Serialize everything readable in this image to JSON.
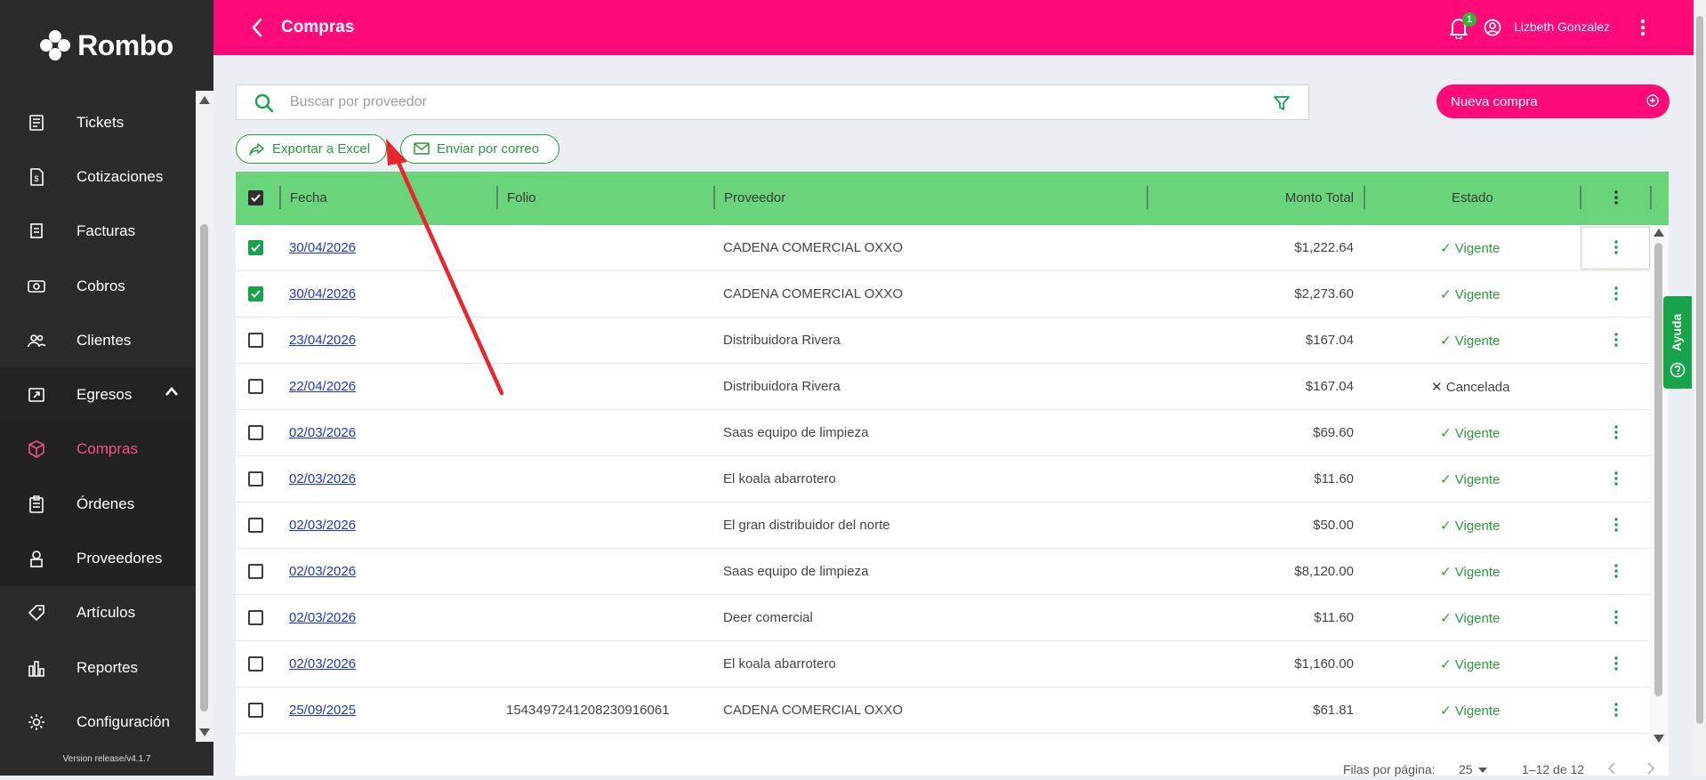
{
  "brand": {
    "name": "Rombo"
  },
  "sidebar": {
    "items": [
      {
        "label": "Tickets",
        "icon": "ticket-icon"
      },
      {
        "label": "Cotizaciones",
        "icon": "quote-icon"
      },
      {
        "label": "Facturas",
        "icon": "invoice-icon"
      },
      {
        "label": "Cobros",
        "icon": "cash-icon"
      },
      {
        "label": "Clientes",
        "icon": "clients-icon"
      },
      {
        "label": "Egresos",
        "icon": "expenses-icon"
      },
      {
        "label": "Compras",
        "icon": "box-icon"
      },
      {
        "label": "Órdenes",
        "icon": "clipboard-icon"
      },
      {
        "label": "Proveedores",
        "icon": "supplier-icon"
      },
      {
        "label": "Artículos",
        "icon": "tag-icon"
      },
      {
        "label": "Reportes",
        "icon": "chart-icon"
      },
      {
        "label": "Configuración",
        "icon": "gear-icon"
      }
    ],
    "version": "Version release/v4.1.7"
  },
  "header": {
    "title": "Compras",
    "notifications": "1",
    "user": "Lizbeth Gonzalez"
  },
  "search": {
    "placeholder": "Buscar por proveedor"
  },
  "actions": {
    "new": "Nueva compra",
    "export": "Exportar a Excel",
    "email": "Enviar por correo"
  },
  "table": {
    "columns": [
      "Fecha",
      "Folio",
      "Proveedor",
      "Monto Total",
      "Estado"
    ],
    "rows": [
      {
        "checked": true,
        "date": "30/04/2026",
        "folio": "",
        "supplier": "CADENA COMERCIAL OXXO",
        "amount": "$1,222.64",
        "status": "Vigente"
      },
      {
        "checked": true,
        "date": "30/04/2026",
        "folio": "",
        "supplier": "CADENA COMERCIAL OXXO",
        "amount": "$2,273.60",
        "status": "Vigente"
      },
      {
        "checked": false,
        "date": "23/04/2026",
        "folio": "",
        "supplier": "Distribuidora Rivera",
        "amount": "$167.04",
        "status": "Vigente"
      },
      {
        "checked": false,
        "date": "22/04/2026",
        "folio": "",
        "supplier": "Distribuidora Rivera",
        "amount": "$167.04",
        "status": "Cancelada"
      },
      {
        "checked": false,
        "date": "02/03/2026",
        "folio": "",
        "supplier": "Saas equipo de limpieza",
        "amount": "$69.60",
        "status": "Vigente"
      },
      {
        "checked": false,
        "date": "02/03/2026",
        "folio": "",
        "supplier": "El koala abarrotero",
        "amount": "$11.60",
        "status": "Vigente"
      },
      {
        "checked": false,
        "date": "02/03/2026",
        "folio": "",
        "supplier": "El gran distribuidor del norte",
        "amount": "$50.00",
        "status": "Vigente"
      },
      {
        "checked": false,
        "date": "02/03/2026",
        "folio": "",
        "supplier": "Saas equipo de limpieza",
        "amount": "$8,120.00",
        "status": "Vigente"
      },
      {
        "checked": false,
        "date": "02/03/2026",
        "folio": "",
        "supplier": "Deer comercial",
        "amount": "$11.60",
        "status": "Vigente"
      },
      {
        "checked": false,
        "date": "02/03/2026",
        "folio": "",
        "supplier": "El koala abarrotero",
        "amount": "$1,160.00",
        "status": "Vigente"
      },
      {
        "checked": false,
        "date": "25/09/2025",
        "folio": "1543497241208230916061",
        "supplier": "CADENA COMERCIAL OXXO",
        "amount": "$61.81",
        "status": "Vigente"
      }
    ]
  },
  "pagination": {
    "rows_label": "Filas por página:",
    "per_page": "25",
    "range": "1–12 de 12"
  },
  "help": {
    "label": "Ayuda"
  },
  "colors": {
    "brand": "#ff0a78",
    "header_green": "#69d47a",
    "accent_green": "#16a34a",
    "sidebar": "#2b2b2b"
  }
}
